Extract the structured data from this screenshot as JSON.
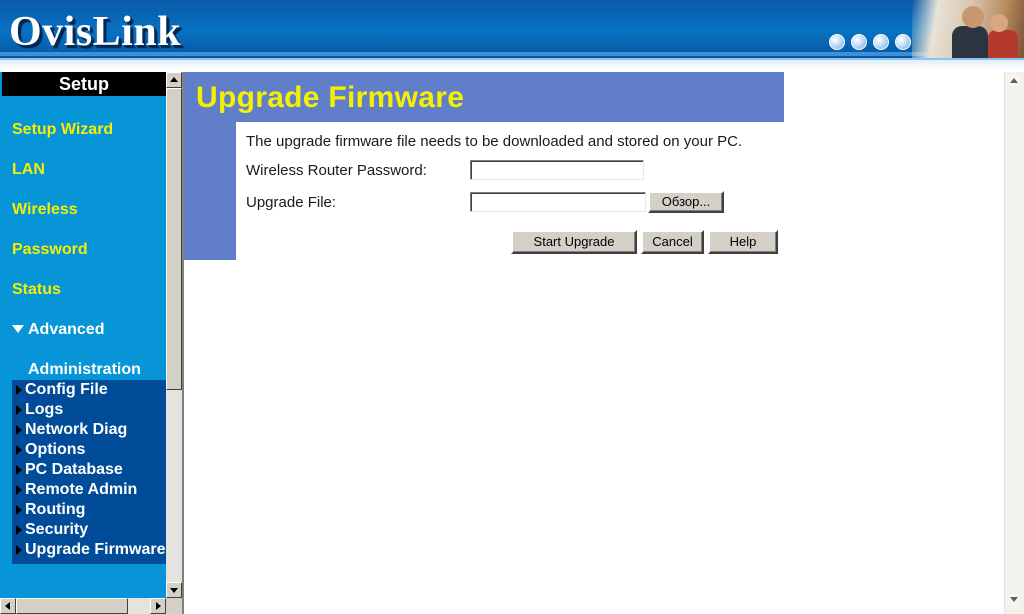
{
  "header": {
    "brand": "OvisLink",
    "globe_icons": [
      "globe-icon",
      "globe-icon",
      "globe-icon",
      "globe-icon"
    ]
  },
  "sidebar": {
    "title": "Setup",
    "links": [
      {
        "label": "Setup Wizard"
      },
      {
        "label": "LAN"
      },
      {
        "label": "Wireless"
      },
      {
        "label": "Password"
      },
      {
        "label": "Status"
      }
    ],
    "advanced_label": "Advanced",
    "admin_heading": "Administration",
    "admin_items": [
      {
        "label": "Config File"
      },
      {
        "label": "Logs"
      },
      {
        "label": "Network Diag"
      },
      {
        "label": "Options"
      },
      {
        "label": "PC Database"
      },
      {
        "label": "Remote Admin"
      },
      {
        "label": "Routing"
      },
      {
        "label": "Security"
      },
      {
        "label": "Upgrade Firmware"
      }
    ]
  },
  "main": {
    "title": "Upgrade Firmware",
    "description": "The upgrade firmware file needs to be downloaded and stored on your PC.",
    "password_label": "Wireless Router Password:",
    "password_value": "",
    "file_label": "Upgrade File:",
    "file_value": "",
    "browse_label": "Обзор...",
    "start_label": "Start Upgrade",
    "cancel_label": "Cancel",
    "help_label": "Help"
  },
  "colors": {
    "header_blue": "#0871c2",
    "sidebar_blue": "#0795d8",
    "submenu_blue": "#004c99",
    "link_yellow": "#f5f000",
    "title_bar": "#617fc8"
  }
}
